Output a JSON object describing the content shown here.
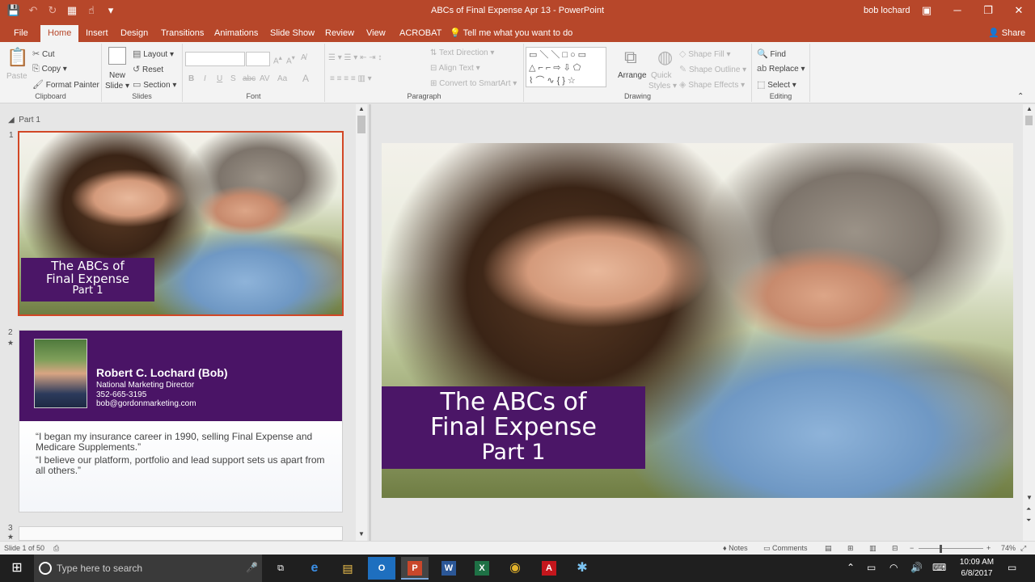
{
  "window": {
    "title": "ABCs of Final Expense Apr 13  -  PowerPoint",
    "user": "bob lochard"
  },
  "tabs": [
    "File",
    "Home",
    "Insert",
    "Design",
    "Transitions",
    "Animations",
    "Slide Show",
    "Review",
    "View",
    "ACROBAT"
  ],
  "tell_me": "Tell me what you want to do",
  "share": "Share",
  "ribbon": {
    "clipboard": {
      "paste": "Paste",
      "cut": "Cut",
      "copy": "Copy",
      "format_painter": "Format Painter",
      "label": "Clipboard"
    },
    "slides": {
      "new_slide_1": "New",
      "new_slide_2": "Slide",
      "layout": "Layout",
      "reset": "Reset",
      "section": "Section",
      "label": "Slides"
    },
    "font": {
      "label": "Font",
      "bold": "B",
      "italic": "I",
      "underline": "U",
      "shadow": "S",
      "strike": "abc",
      "spacing": "AV",
      "case": "Aa",
      "color": "A"
    },
    "paragraph": {
      "text_direction": "Text Direction",
      "align_text": "Align Text",
      "convert": "Convert to SmartArt",
      "label": "Paragraph"
    },
    "drawing": {
      "arrange": "Arrange",
      "quick_styles_1": "Quick",
      "quick_styles_2": "Styles",
      "shape_fill": "Shape Fill",
      "shape_outline": "Shape Outline",
      "shape_effects": "Shape Effects",
      "label": "Drawing"
    },
    "editing": {
      "find": "Find",
      "replace": "Replace",
      "select": "Select",
      "label": "Editing"
    }
  },
  "section_name": "Part 1",
  "slides": {
    "s1": {
      "num": "1",
      "title_line1": "The ABCs of",
      "title_line2": "Final Expense",
      "title_line3": "Part 1"
    },
    "s2": {
      "num": "2",
      "star": "★",
      "name": "Robert C. Lochard (Bob)",
      "role": "National Marketing Director",
      "phone": "352-665-3195",
      "email": "bob@gordonmarketing.com",
      "quote1": "“I began my insurance career in 1990, selling Final Expense and Medicare Supplements.”",
      "quote2": "“I believe our platform, portfolio and lead support sets us apart from all others.”"
    },
    "s3": {
      "num": "3",
      "star": "★"
    }
  },
  "status": {
    "slide_info": "Slide 1 of 50",
    "notes": "Notes",
    "comments": "Comments",
    "zoom": "74%"
  },
  "taskbar": {
    "search_placeholder": "Type here to search",
    "apps": [
      "e",
      "▤",
      "O",
      "P",
      "W",
      "X",
      "◉",
      "A",
      "✱"
    ],
    "time": "10:09 AM",
    "date": "6/8/2017"
  },
  "colors": {
    "brand": "#b7472a",
    "slide_title_bg": "#4b1667"
  }
}
